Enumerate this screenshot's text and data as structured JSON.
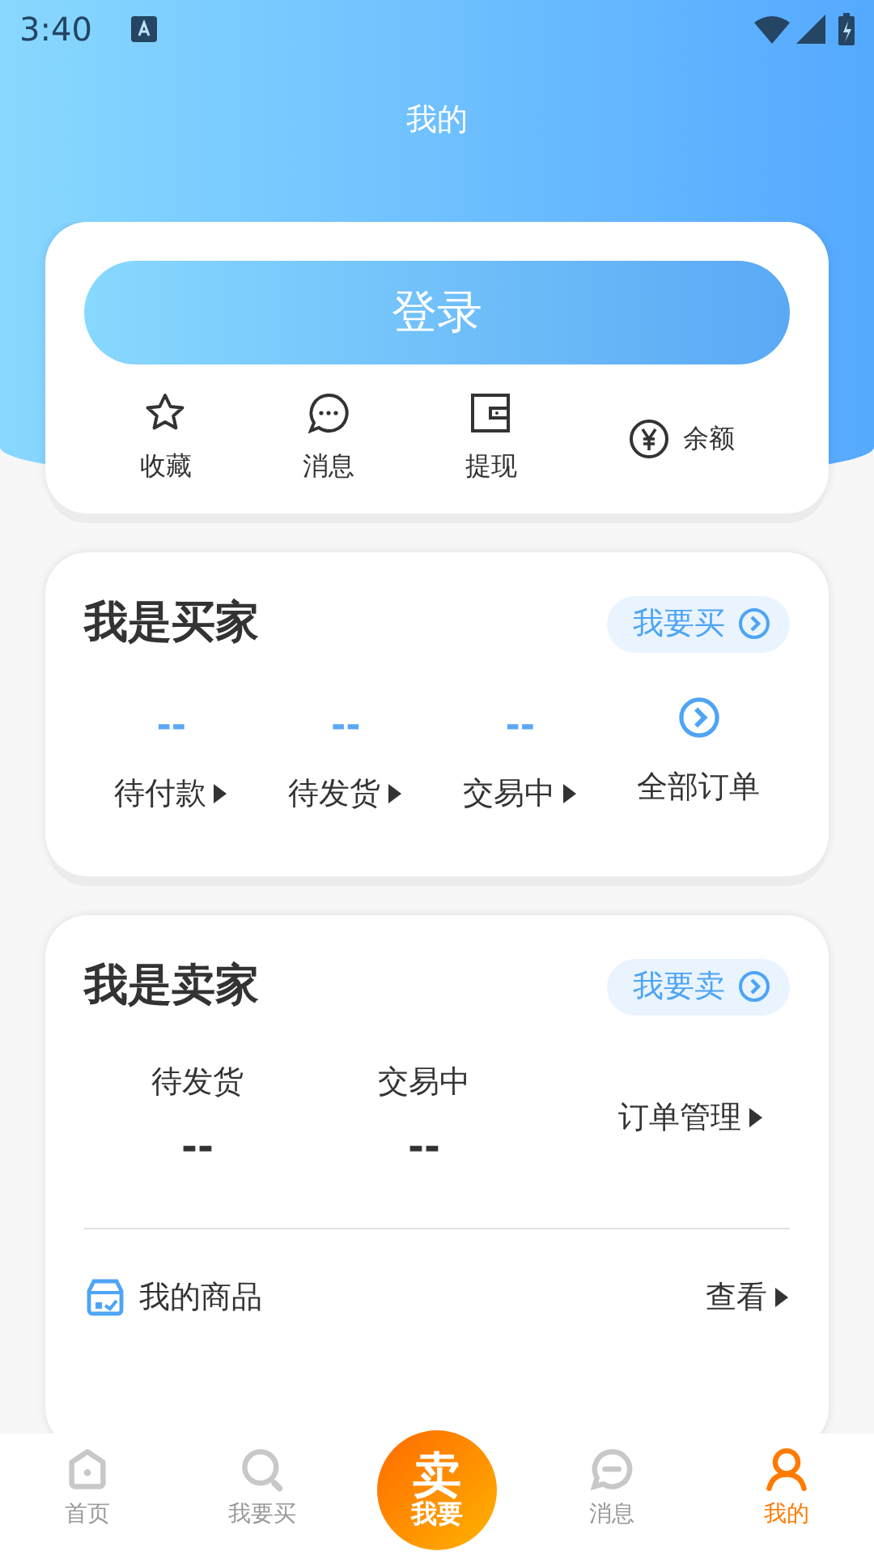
{
  "status_bar": {
    "time": "3:40"
  },
  "header": {
    "title": "我的"
  },
  "login_button": "登录",
  "quick_actions": [
    {
      "label": "收藏",
      "kind": "stacked"
    },
    {
      "label": "消息",
      "kind": "stacked"
    },
    {
      "label": "提现",
      "kind": "stacked"
    },
    {
      "label": "余额",
      "kind": "inline"
    }
  ],
  "buyer": {
    "title": "我是买家",
    "action": "我要买",
    "stats": [
      {
        "kind": "count",
        "value": "--",
        "label": "待付款"
      },
      {
        "kind": "count",
        "value": "--",
        "label": "待发货"
      },
      {
        "kind": "count",
        "value": "--",
        "label": "交易中"
      },
      {
        "kind": "link",
        "label": "全部订单"
      }
    ]
  },
  "seller": {
    "title": "我是卖家",
    "action": "我要卖",
    "stats": [
      {
        "label": "待发货",
        "value": "--"
      },
      {
        "label": "交易中",
        "value": "--"
      }
    ],
    "manage": "订单管理",
    "goods": {
      "label": "我的商品",
      "link": "查看"
    }
  },
  "tab_bar": [
    {
      "kind": "tab",
      "label": "首页",
      "selected": false
    },
    {
      "kind": "tab",
      "label": "我要买",
      "selected": false
    },
    {
      "kind": "center",
      "top": "卖",
      "bottom": "我要"
    },
    {
      "kind": "tab",
      "label": "消息",
      "selected": false
    },
    {
      "kind": "tab",
      "label": "我的",
      "selected": true
    }
  ]
}
